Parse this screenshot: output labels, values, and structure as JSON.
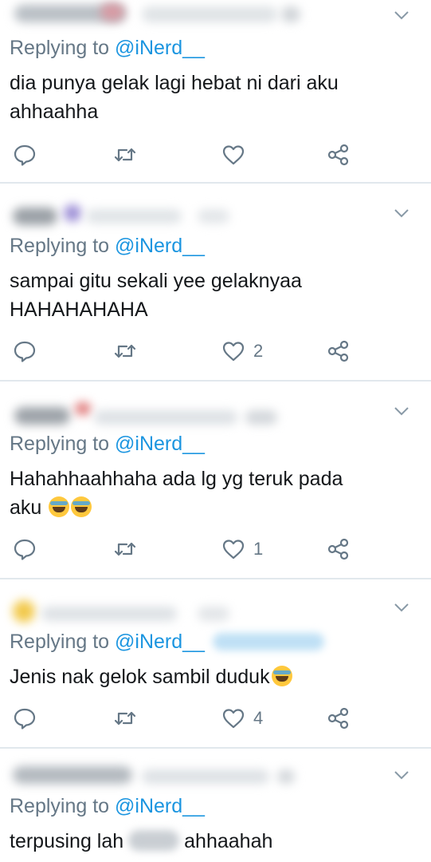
{
  "colors": {
    "link": "#1b95e0",
    "muted": "#657786",
    "text": "#14171a",
    "divider": "#e1e8ed"
  },
  "icons": [
    "reply-icon",
    "retweet-icon",
    "like-icon",
    "share-icon",
    "chevron-down-icon"
  ],
  "replies": [
    {
      "replying_prefix": "Replying to ",
      "handle": "@iNerd__",
      "line1": "dia punya gelak lagi hebat ni dari aku",
      "line2": "ahhaahha",
      "like_count": ""
    },
    {
      "replying_prefix": "Replying to ",
      "handle": "@iNerd__",
      "line1": "sampai gitu sekali yee gelaknyaa",
      "line2": "HAHAHAHAHA",
      "like_count": "2"
    },
    {
      "replying_prefix": "Replying to ",
      "handle": "@iNerd__",
      "line1": "Hahahhaahhaha ada lg yg teruk pada",
      "line2": "aku",
      "like_count": "1"
    },
    {
      "replying_prefix": "Replying to ",
      "handle": "@iNerd__",
      "line1": "Jenis nak gelok sambil duduk",
      "line2": "",
      "like_count": "4"
    },
    {
      "replying_prefix": "Replying to ",
      "handle": "@iNerd__",
      "line1": "terpusing lah",
      "line2": "ahhaahah",
      "like_count": ""
    }
  ]
}
